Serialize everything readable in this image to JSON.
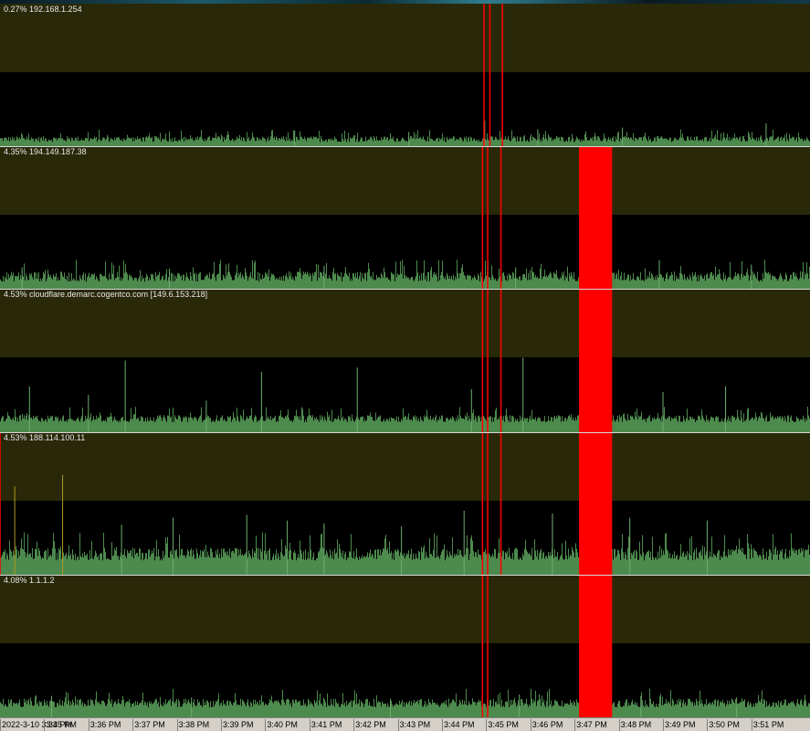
{
  "colors": {
    "background": "#000000",
    "band": "#29290a",
    "latency": "#4d8a4d",
    "packet_loss": "#ff0000",
    "spike": "#b09a20",
    "divider": "#d8d8d8",
    "axis_bg": "#d4d0c8"
  },
  "time_axis": {
    "labels": [
      "2022-3-10 3:34 PM",
      "3:35 PM",
      "3:36 PM",
      "3:37 PM",
      "3:38 PM",
      "3:39 PM",
      "3:40 PM",
      "3:41 PM",
      "3:42 PM",
      "3:43 PM",
      "3:44 PM",
      "3:45 PM",
      "3:46 PM",
      "3:47 PM",
      "3:48 PM",
      "3:49 PM",
      "3:50 PM",
      "3:51 PM"
    ]
  },
  "chart_data": {
    "type": "area",
    "x_range": [
      "3:34 PM",
      "3:51 PM"
    ],
    "x_ticks": [
      "3:34 PM",
      "3:35 PM",
      "3:36 PM",
      "3:37 PM",
      "3:38 PM",
      "3:39 PM",
      "3:40 PM",
      "3:41 PM",
      "3:42 PM",
      "3:43 PM",
      "3:44 PM",
      "3:45 PM",
      "3:46 PM",
      "3:47 PM",
      "3:48 PM",
      "3:49 PM",
      "3:50 PM",
      "3:51 PM"
    ],
    "grid": false,
    "series": [
      {
        "label": "0.27% 192.168.1.254",
        "baseline": 0.03,
        "noise": 0.04,
        "spikes": [
          {
            "time": "3:44:58 PM",
            "level": 0.18
          },
          {
            "time": "3:46:10 PM",
            "level": 0.12
          },
          {
            "time": "3:48:05 PM",
            "level": 0.13
          },
          {
            "time": "3:51:20 PM",
            "level": 0.16
          },
          {
            "time": "3:40:40 PM",
            "level": 0.11
          },
          {
            "time": "3:43:15 PM",
            "level": 0.1
          }
        ],
        "packet_loss_times": [
          "3:44:57 PM",
          "3:45:05 PM",
          "3:45:22 PM"
        ]
      },
      {
        "label": "4.35% 194.149.187.38",
        "baseline": 0.05,
        "noise": 0.07,
        "spikes": [
          {
            "time": "3:34:30 PM",
            "level": 0.15
          },
          {
            "time": "3:37:50 PM",
            "level": 0.14
          },
          {
            "time": "3:41:20 PM",
            "level": 0.16
          },
          {
            "time": "3:45:40 PM",
            "level": 0.15
          },
          {
            "time": "3:48:55 PM",
            "level": 0.2
          },
          {
            "time": "3:51:00 PM",
            "level": 0.17
          }
        ],
        "packet_loss_times": [
          "3:44:55 PM",
          "3:45:02 PM",
          "3:45:20 PM"
        ],
        "outage": [
          "3:47:06 PM",
          "3:47:51 PM"
        ]
      },
      {
        "label": "4.53% cloudflare.demarc.cogentco.com [149.6.153.218]",
        "baseline": 0.07,
        "noise": 0.05,
        "spikes": [
          {
            "time": "3:34:40 PM",
            "level": 0.32
          },
          {
            "time": "3:36:00 PM",
            "level": 0.26
          },
          {
            "time": "3:36:50 PM",
            "level": 0.5
          },
          {
            "time": "3:38:40 PM",
            "level": 0.22
          },
          {
            "time": "3:39:55 PM",
            "level": 0.42
          },
          {
            "time": "3:42:05 PM",
            "level": 0.45
          },
          {
            "time": "3:44:40 PM",
            "level": 0.3
          },
          {
            "time": "3:45:50 PM",
            "level": 0.52
          },
          {
            "time": "3:49:00 PM",
            "level": 0.28
          },
          {
            "time": "3:50:25 PM",
            "level": 0.32
          }
        ],
        "packet_loss_times": [
          "3:44:55 PM",
          "3:45:02 PM",
          "3:45:20 PM"
        ],
        "outage": [
          "3:47:06 PM",
          "3:47:51 PM"
        ]
      },
      {
        "label": "4.53% 188.114.100.11",
        "baseline": 0.1,
        "noise": 0.09,
        "spikes": [
          {
            "time": "3:34:20 PM",
            "level": 0.62,
            "highlight": true
          },
          {
            "time": "3:35:25 PM",
            "level": 0.7,
            "highlight": true
          },
          {
            "time": "3:36:45 PM",
            "level": 0.35
          },
          {
            "time": "3:37:55 PM",
            "level": 0.4
          },
          {
            "time": "3:39:35 PM",
            "level": 0.42
          },
          {
            "time": "3:40:30 PM",
            "level": 0.38
          },
          {
            "time": "3:41:20 PM",
            "level": 0.36
          },
          {
            "time": "3:43:05 PM",
            "level": 0.34
          },
          {
            "time": "3:44:30 PM",
            "level": 0.45
          },
          {
            "time": "3:46:30 PM",
            "level": 0.43
          },
          {
            "time": "3:48:15 PM",
            "level": 0.4
          },
          {
            "time": "3:50:00 PM",
            "level": 0.38
          }
        ],
        "packet_loss_times": [
          "3:34:00 PM",
          "3:44:55 PM",
          "3:45:02 PM",
          "3:45:20 PM"
        ],
        "outage": [
          "3:47:06 PM",
          "3:47:51 PM"
        ]
      },
      {
        "label": "4.08% 1.1.1.2",
        "baseline": 0.07,
        "noise": 0.06,
        "spikes": [
          {
            "time": "3:35:10 PM",
            "level": 0.15
          },
          {
            "time": "3:38:20 PM",
            "level": 0.14
          },
          {
            "time": "3:42:50 PM",
            "level": 0.13
          },
          {
            "time": "3:45:45 PM",
            "level": 0.16
          },
          {
            "time": "3:48:30 PM",
            "level": 0.15
          },
          {
            "time": "3:50:40 PM",
            "level": 0.14
          }
        ],
        "packet_loss_times": [
          "3:44:55 PM",
          "3:45:02 PM"
        ],
        "outage": [
          "3:47:06 PM",
          "3:47:51 PM"
        ]
      }
    ]
  }
}
